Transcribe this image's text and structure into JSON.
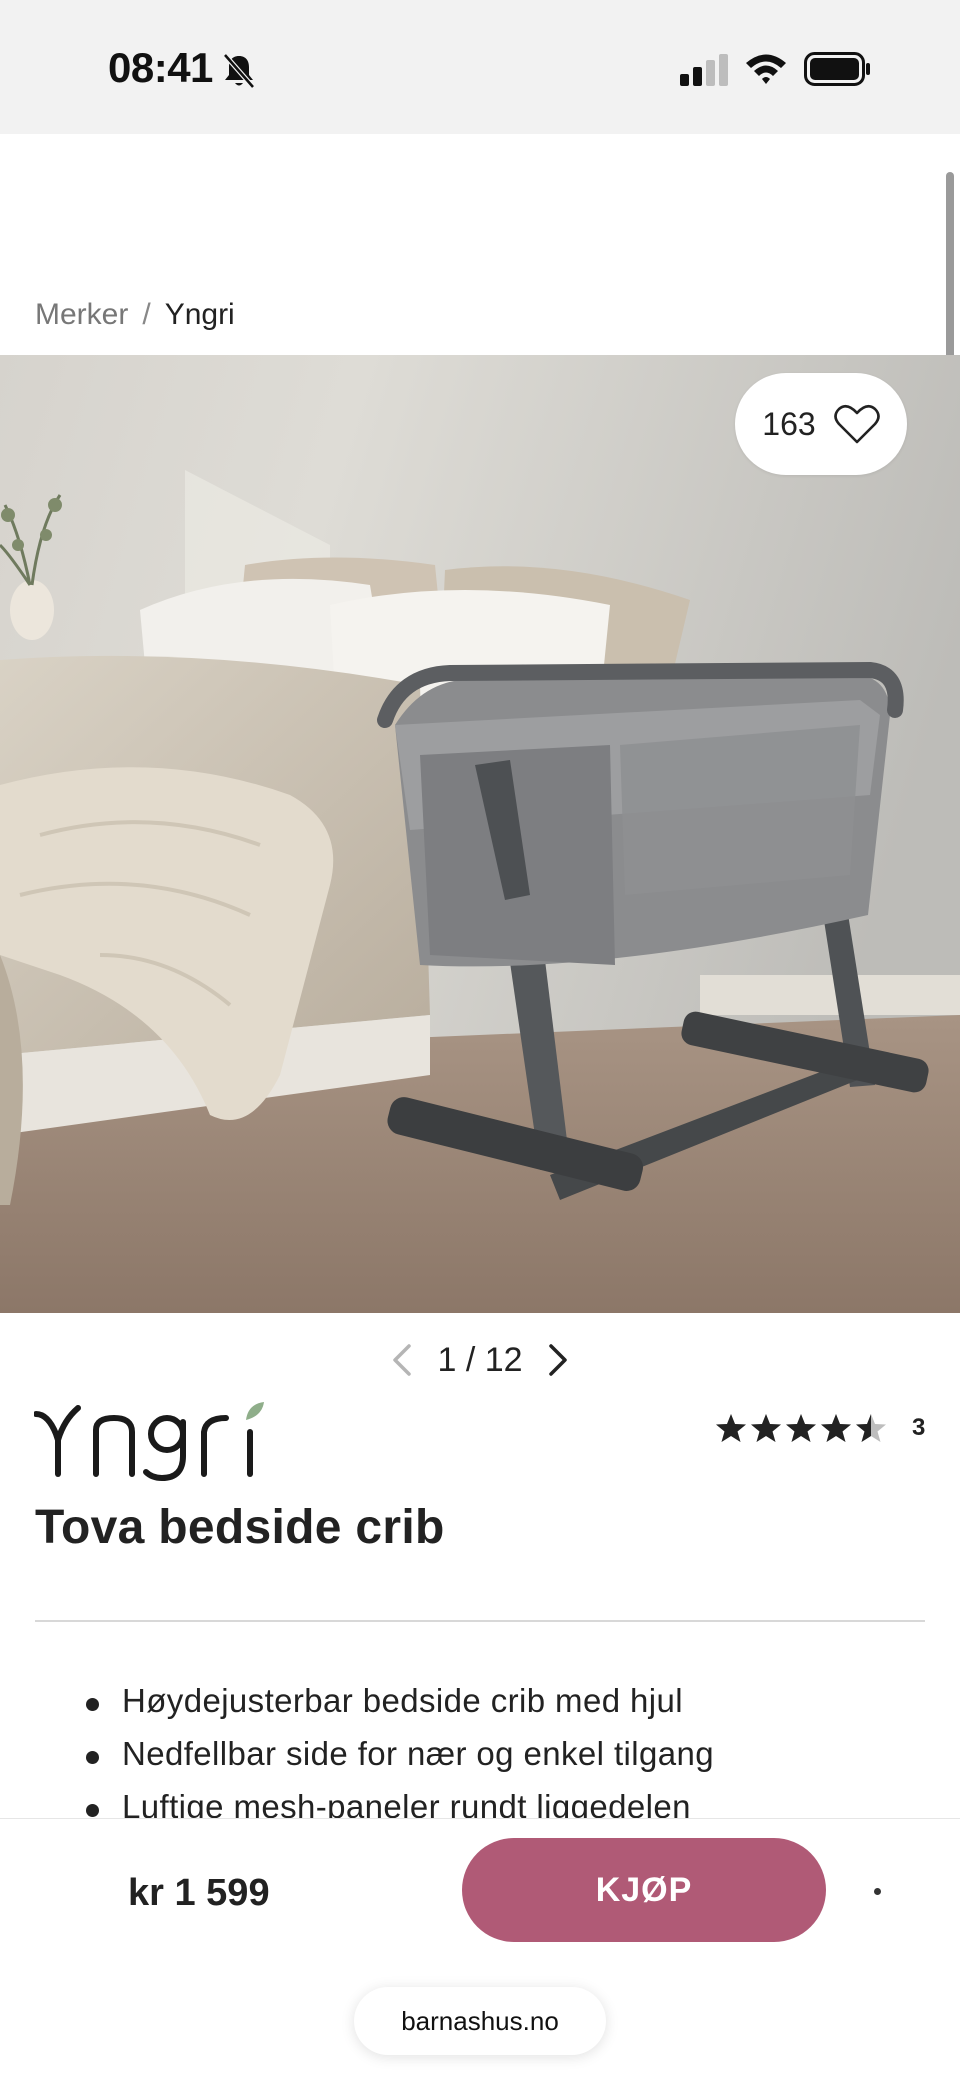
{
  "status_bar": {
    "time": "08:41",
    "icons": [
      "bell-muted-icon",
      "signal-icon",
      "wifi-icon",
      "battery-icon"
    ]
  },
  "breadcrumb": {
    "parent": "Merker",
    "separator": "/",
    "current": "Yngri"
  },
  "gallery": {
    "like_count": "163",
    "page_current": "1",
    "page_total": "12",
    "page_separator": "/"
  },
  "product": {
    "brand": "Yngri",
    "title": "Tova bedside crib",
    "rating": 4.5,
    "rating_max": 5,
    "review_count": "3",
    "features": [
      "Høydejusterbar bedside crib med hjul",
      "Nedfellbar side for nær og enkel tilgang",
      "Luftige mesh-paneler rundt liggedelen"
    ]
  },
  "buy_bar": {
    "price": "kr 1 599",
    "buy_label": "KJØP"
  },
  "browser": {
    "domain": "barnashus.no"
  },
  "colors": {
    "accent": "#b05a76",
    "status_bar_bg": "#f2f2f2",
    "text": "#222222"
  }
}
